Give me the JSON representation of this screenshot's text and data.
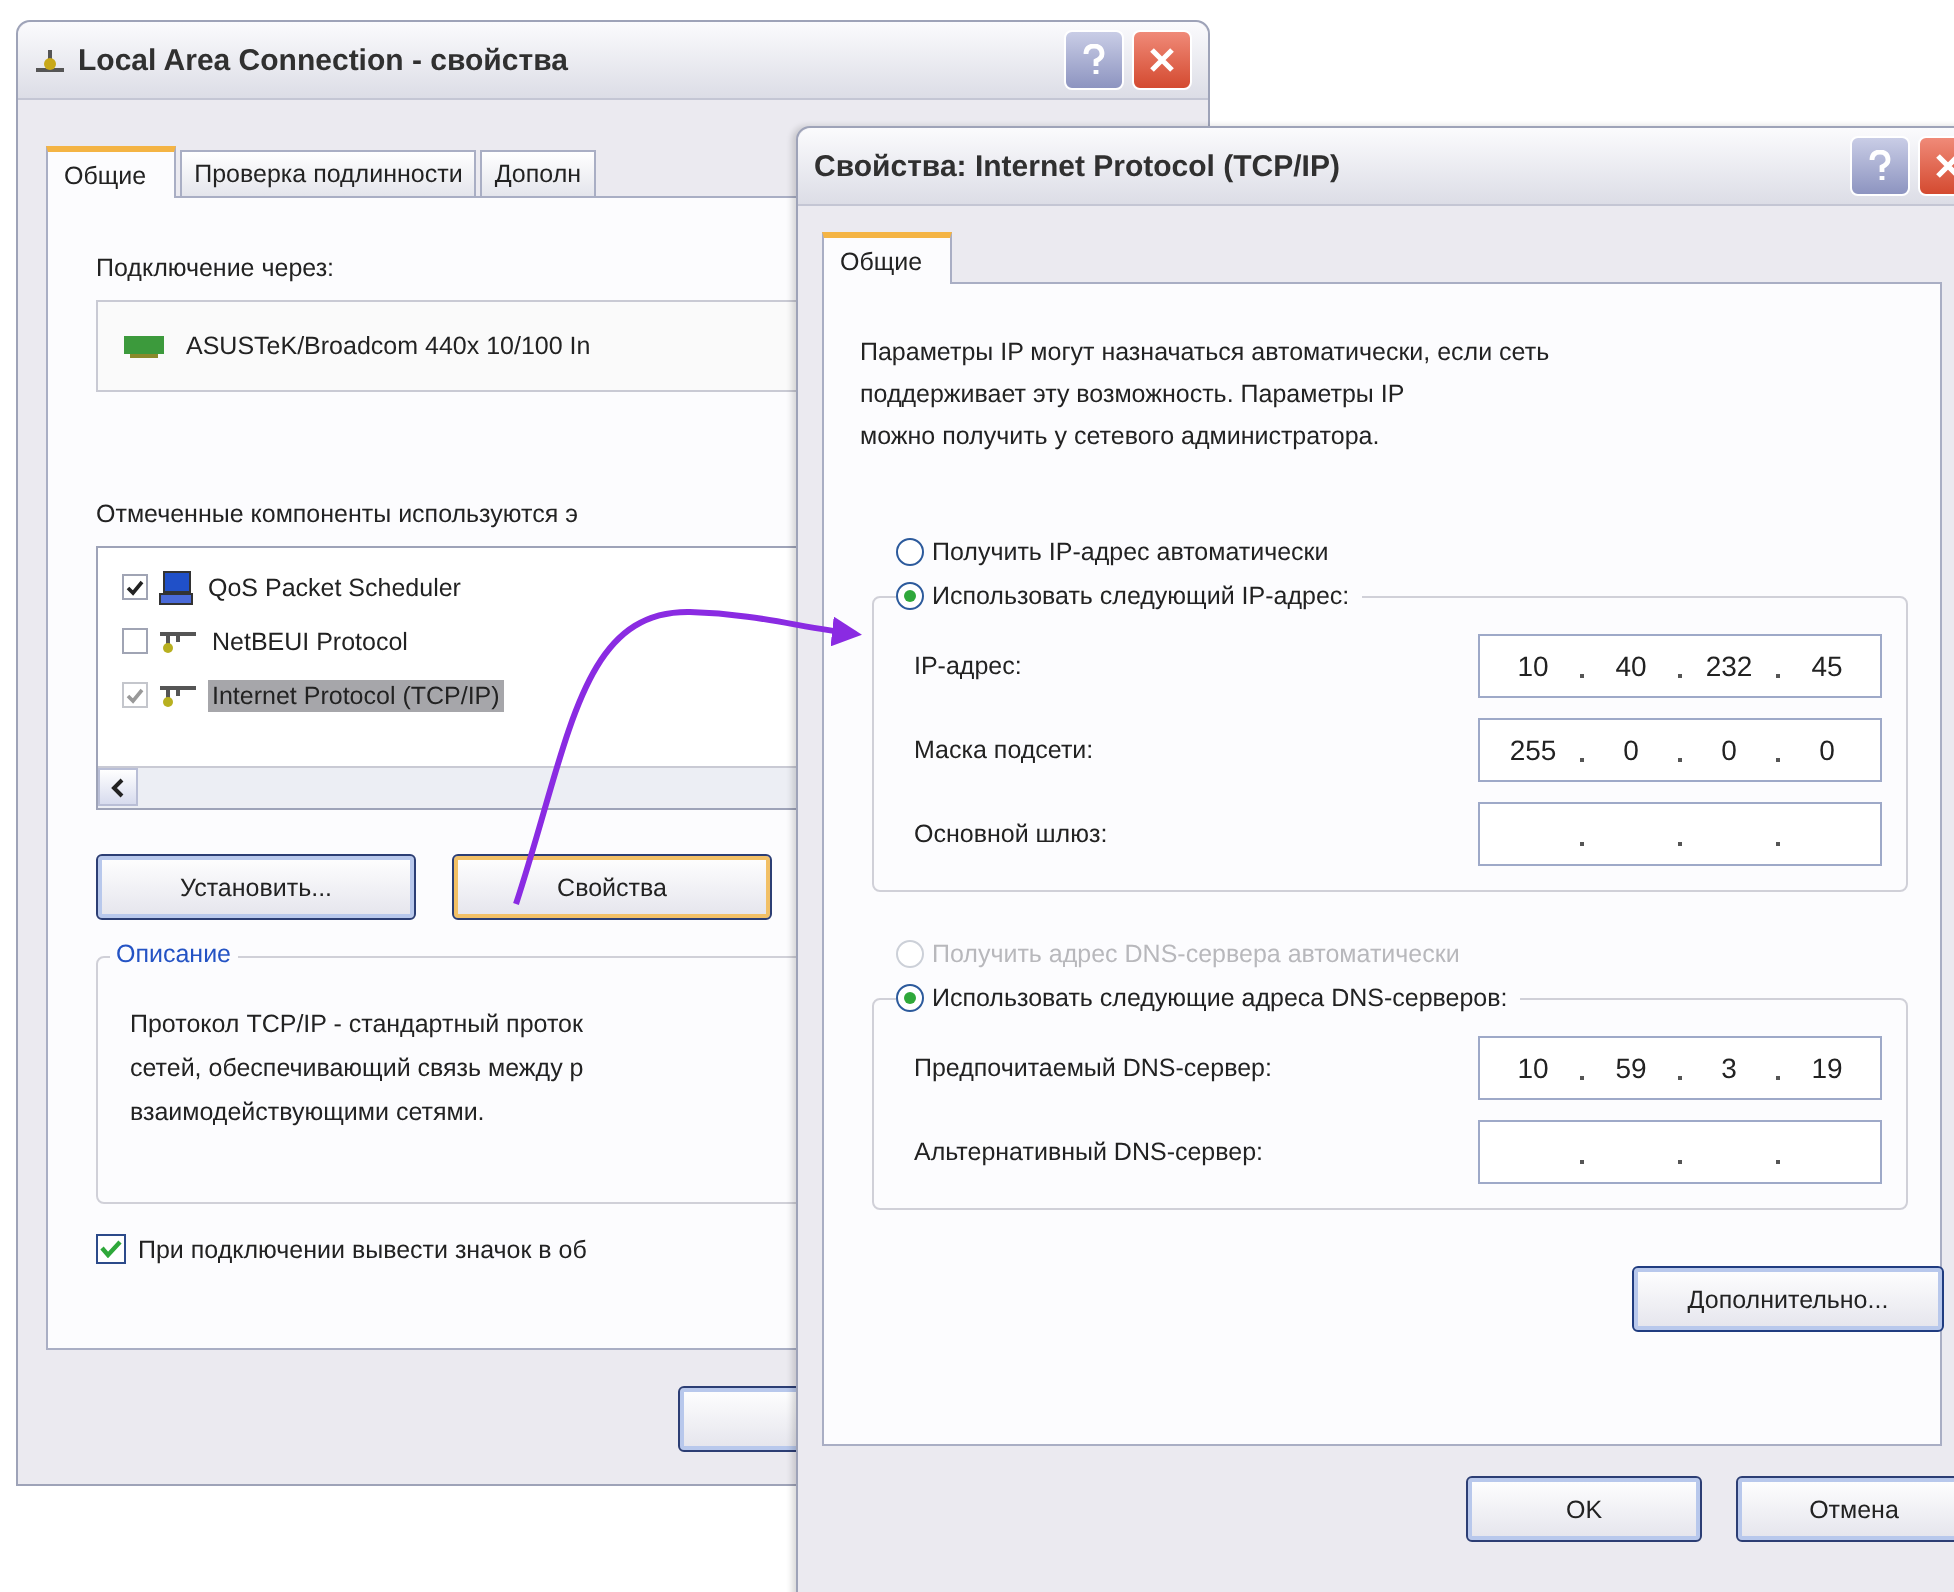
{
  "back_window": {
    "title": "Local Area Connection - свойства",
    "tabs": [
      {
        "label": "Общие",
        "selected": true
      },
      {
        "label": "Проверка подлинности",
        "selected": false
      },
      {
        "label": "Дополн",
        "selected": false
      }
    ],
    "connect_label": "Подключение через:",
    "adapter": "ASUSTeK/Broadcom 440x 10/100 In",
    "components_label": "Отмеченные компоненты используются э",
    "components": [
      {
        "name": "QoS Packet Scheduler",
        "checked": true,
        "selected": false,
        "kind": "scheduler"
      },
      {
        "name": "NetBEUI Protocol",
        "checked": false,
        "selected": false,
        "kind": "protocol"
      },
      {
        "name": "Internet Protocol (TCP/IP)",
        "checked": true,
        "selected": true,
        "kind": "protocol"
      }
    ],
    "buttons": [
      {
        "label": "Установить...",
        "focused": false
      },
      {
        "label": "Свойства",
        "focused": true
      }
    ],
    "description": {
      "legend": "Описание",
      "text": [
        "Протокол TCP/IP - стандартный проток",
        "сетей, обеспечивающий связь между р",
        "взаимодействующими сетями."
      ]
    },
    "tray_checkbox": {
      "label": "При подключении вывести значок в об",
      "checked": true
    }
  },
  "front_window": {
    "title": "Свойства: Internet Protocol (TCP/IP)",
    "tabs": [
      {
        "label": "Общие",
        "selected": true
      }
    ],
    "intro": [
      "Параметры IP могут назначаться автоматически, если сеть",
      "поддерживает эту возможность. Параметры IP",
      "можно получить у сетевого администратора."
    ],
    "ip_groups": [
      {
        "options": [
          {
            "label": "Получить IP-адрес автоматически",
            "selected": false,
            "disabled": false
          },
          {
            "label": "Использовать следующий IP-адрес:",
            "selected": true,
            "disabled": false
          }
        ],
        "fields": [
          {
            "label": "IP-адрес:",
            "octets": [
              "10",
              "40",
              "232",
              "45"
            ]
          },
          {
            "label": "Маска подсети:",
            "octets": [
              "255",
              "0",
              "0",
              "0"
            ]
          },
          {
            "label": "Основной шлюз:"
          }
        ]
      },
      {
        "options": [
          {
            "label": "Получить адрес DNS-сервера автоматически",
            "selected": false,
            "disabled": true
          },
          {
            "label": "Использовать следующие адреса DNS-серверов:",
            "selected": true,
            "disabled": false
          }
        ],
        "fields": [
          {
            "label": "Предпочитаемый DNS-сервер:",
            "octets": [
              "10",
              "59",
              "3",
              "19"
            ]
          },
          {
            "label": "Альтернативный DNS-сервер:"
          }
        ]
      }
    ],
    "advanced_button": "Дополнительно...",
    "buttons": [
      "OK",
      "Отмена"
    ]
  }
}
